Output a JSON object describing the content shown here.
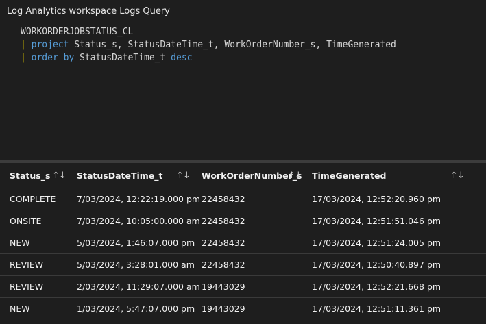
{
  "header": {
    "title": "Log Analytics workspace Logs Query"
  },
  "query": {
    "line1": {
      "table": "WORKORDERJOBSTATUS_CL"
    },
    "line2": {
      "pipe": "|",
      "keyword": "project",
      "rest": " Status_s, StatusDateTime_t, WorkOrderNumber_s, TimeGenerated"
    },
    "line3": {
      "pipe": "|",
      "keyword": "order by",
      "rest": " StatusDateTime_t ",
      "keyword2": "desc"
    }
  },
  "table": {
    "sort_icon": "sort-up-down-icon",
    "sort_glyph": "↑↓",
    "columns": [
      "Status_s",
      "StatusDateTime_t",
      "WorkOrderNumber_s",
      "TimeGenerated"
    ],
    "rows": [
      [
        "COMPLETE",
        "7/03/2024, 12:22:19.000 pm",
        "22458432",
        "17/03/2024, 12:52:20.960 pm"
      ],
      [
        "ONSITE",
        "7/03/2024, 10:05:00.000 am",
        "22458432",
        "17/03/2024, 12:51:51.046 pm"
      ],
      [
        "NEW",
        "5/03/2024, 1:46:07.000 pm",
        "22458432",
        "17/03/2024, 12:51:24.005 pm"
      ],
      [
        "REVIEW",
        "5/03/2024, 3:28:01.000 am",
        "22458432",
        "17/03/2024, 12:50:40.897 pm"
      ],
      [
        "REVIEW",
        "2/03/2024, 11:29:07.000 am",
        "19443029",
        "17/03/2024, 12:52:21.668 pm"
      ],
      [
        "NEW",
        "1/03/2024, 5:47:07.000 pm",
        "19443029",
        "17/03/2024, 12:51:11.361 pm"
      ]
    ]
  },
  "colors": {
    "background": "#1e1e1e",
    "keyword": "#569cd6",
    "pipe": "#c8b400",
    "text": "#d4d4d4"
  }
}
